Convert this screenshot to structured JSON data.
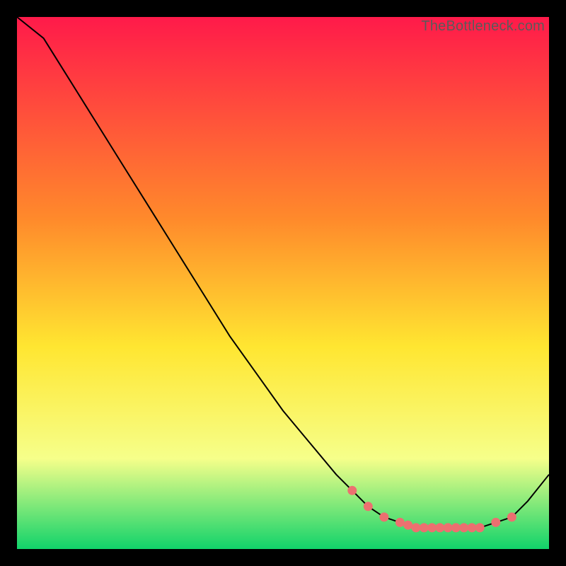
{
  "watermark": "TheBottleneck.com",
  "colors": {
    "line": "#000000",
    "marker_fill": "#ec7070",
    "marker_stroke": "#ec7070",
    "gradient_top": "#ff1a4a",
    "gradient_mid_upper": "#ff8a2b",
    "gradient_mid": "#ffe631",
    "gradient_low": "#f6ff8a",
    "gradient_bottom": "#11d36a",
    "frame_bg": "#000000"
  },
  "chart_data": {
    "type": "line",
    "title": "",
    "xlabel": "",
    "ylabel": "",
    "xlim": [
      0,
      100
    ],
    "ylim": [
      0,
      100
    ],
    "x": [
      0,
      5,
      10,
      15,
      20,
      25,
      30,
      35,
      40,
      45,
      50,
      55,
      60,
      63,
      66,
      69,
      72,
      75,
      78,
      81,
      84,
      87,
      90,
      93,
      96,
      100
    ],
    "y": [
      100,
      96,
      88,
      80,
      72,
      64,
      56,
      48,
      40,
      33,
      26,
      20,
      14,
      11,
      8,
      6,
      5,
      4,
      4,
      4,
      4,
      4,
      5,
      6,
      9,
      14
    ],
    "markers_x": [
      63,
      66,
      69,
      72,
      73.5,
      75,
      76.5,
      78,
      79.5,
      81,
      82.5,
      84,
      85.5,
      87,
      90,
      93
    ],
    "markers_y": [
      11,
      8,
      6,
      5,
      4.5,
      4,
      4,
      4,
      4,
      4,
      4,
      4,
      4,
      4,
      5,
      6
    ]
  }
}
